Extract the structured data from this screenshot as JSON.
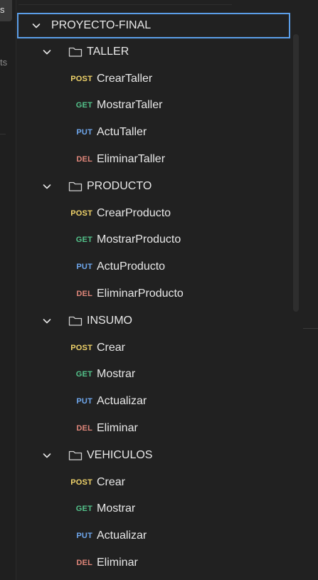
{
  "sidebar_fragments": {
    "active_tab_text": "s",
    "partial_label": "ts"
  },
  "colors": {
    "selection_border": "#5b9ee8",
    "POST": "#f0d36a",
    "GET": "#54c38b",
    "PUT": "#6fa8ee",
    "DEL": "#e0867a"
  },
  "tree": {
    "root": {
      "label": "PROYECTO-FINAL",
      "icon": "chevron-down-icon"
    },
    "folders": [
      {
        "label": "TALLER",
        "requests": [
          {
            "method": "POST",
            "label": "CrearTaller"
          },
          {
            "method": "GET",
            "label": "MostrarTaller"
          },
          {
            "method": "PUT",
            "label": "ActuTaller"
          },
          {
            "method": "DEL",
            "label": "EliminarTaller"
          }
        ]
      },
      {
        "label": "PRODUCTO",
        "requests": [
          {
            "method": "POST",
            "label": "CrearProducto"
          },
          {
            "method": "GET",
            "label": "MostrarProducto"
          },
          {
            "method": "PUT",
            "label": "ActuProducto"
          },
          {
            "method": "DEL",
            "label": "EliminarProducto"
          }
        ]
      },
      {
        "label": "INSUMO",
        "requests": [
          {
            "method": "POST",
            "label": "Crear"
          },
          {
            "method": "GET",
            "label": "Mostrar"
          },
          {
            "method": "PUT",
            "label": "Actualizar"
          },
          {
            "method": "DEL",
            "label": "Eliminar"
          }
        ]
      },
      {
        "label": "VEHICULOS",
        "requests": [
          {
            "method": "POST",
            "label": "Crear"
          },
          {
            "method": "GET",
            "label": "Mostrar"
          },
          {
            "method": "PUT",
            "label": "Actualizar"
          },
          {
            "method": "DEL",
            "label": "Eliminar"
          }
        ]
      }
    ]
  }
}
